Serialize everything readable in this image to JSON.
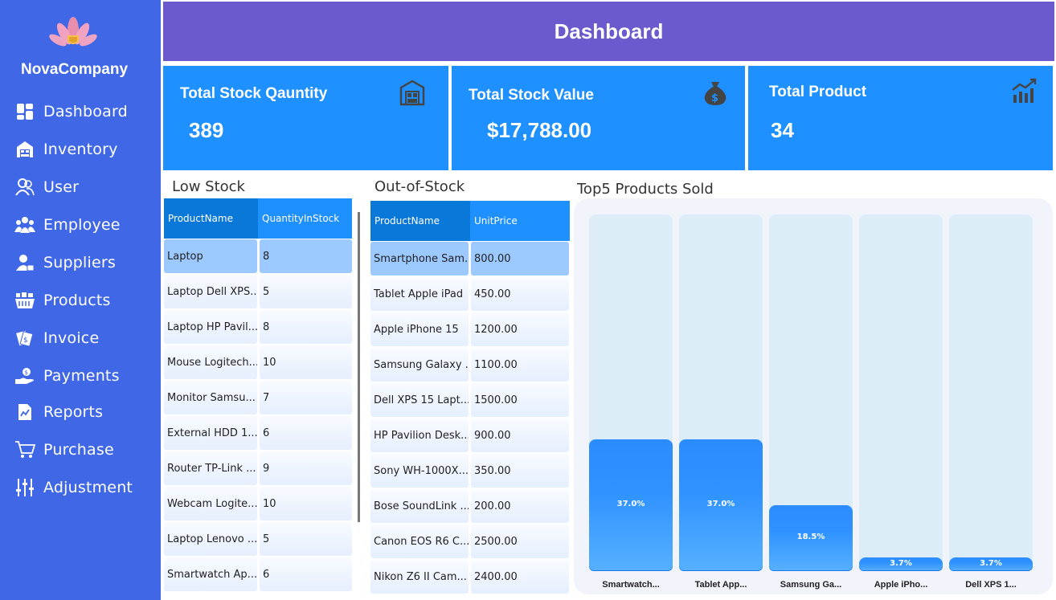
{
  "brand": {
    "name": "NovaCompany"
  },
  "sidebar": {
    "items": [
      {
        "label": "Dashboard",
        "icon": "dashboard-icon"
      },
      {
        "label": "Inventory",
        "icon": "inventory-icon"
      },
      {
        "label": "User",
        "icon": "user-icon"
      },
      {
        "label": "Employee",
        "icon": "employee-icon"
      },
      {
        "label": "Suppliers",
        "icon": "supplier-icon"
      },
      {
        "label": "Products",
        "icon": "products-icon"
      },
      {
        "label": "Invoice",
        "icon": "invoice-icon"
      },
      {
        "label": "Payments",
        "icon": "payments-icon"
      },
      {
        "label": "Reports",
        "icon": "reports-icon"
      },
      {
        "label": "Purchase",
        "icon": "cart-icon"
      },
      {
        "label": "Adjustment",
        "icon": "sliders-icon"
      }
    ]
  },
  "header": {
    "title": "Dashboard"
  },
  "cards": [
    {
      "title": "Total Stock Qauntity",
      "value": "389",
      "icon": "warehouse-icon"
    },
    {
      "title": "Total Stock Value",
      "value": "$17,788.00",
      "icon": "money-bag-icon"
    },
    {
      "title": "Total Product",
      "value": "34",
      "icon": "growth-chart-icon"
    }
  ],
  "low_stock": {
    "title": "Low Stock",
    "columns": [
      "ProductName",
      "QuantityInStock"
    ],
    "rows": [
      [
        "Laptop",
        "8"
      ],
      [
        "Laptop Dell XPS...",
        "5"
      ],
      [
        "Laptop HP Pavil...",
        "8"
      ],
      [
        "Mouse Logitech...",
        "10"
      ],
      [
        "Monitor Samsu...",
        "7"
      ],
      [
        "External HDD 1...",
        "6"
      ],
      [
        "Router TP-Link ...",
        "9"
      ],
      [
        "Webcam Logite...",
        "10"
      ],
      [
        "Laptop Lenovo ...",
        "5"
      ],
      [
        "Smartwatch Ap...",
        "6"
      ]
    ]
  },
  "out_of_stock": {
    "title": "Out-of-Stock",
    "columns": [
      "ProductName",
      "UnitPrice"
    ],
    "rows": [
      [
        "Smartphone Sam...",
        "800.00"
      ],
      [
        "Tablet Apple iPad",
        "450.00"
      ],
      [
        "Apple iPhone 15",
        "1200.00"
      ],
      [
        "Samsung Galaxy ...",
        "1100.00"
      ],
      [
        "Dell XPS 15 Lapt...",
        "1500.00"
      ],
      [
        "HP Pavilion Desk...",
        "900.00"
      ],
      [
        "Sony WH-1000X...",
        "350.00"
      ],
      [
        "Bose SoundLink ...",
        "200.00"
      ],
      [
        "Canon EOS R6 C...",
        "2500.00"
      ],
      [
        "Nikon Z6 II Cam...",
        "2400.00"
      ]
    ]
  },
  "colors": {
    "sidebar": "#3f67e6",
    "header": "#6a5acd",
    "card": "#1e90ff",
    "grid_header": "#1e90ff",
    "grid_header_active": "#0a78d8",
    "bar": "#2f92ff",
    "track": "#ddedf8"
  },
  "chart_data": {
    "type": "bar",
    "title": "Top5 Products Sold",
    "categories": [
      "Smartwatch...",
      "Tablet App...",
      "Samsung Ga...",
      "Apple iPho...",
      "Dell XPS 1..."
    ],
    "values": [
      37.0,
      37.0,
      18.5,
      3.7,
      3.7
    ],
    "labels": [
      "37.0%",
      "37.0%",
      "18.5%",
      "3.7%",
      "3.7%"
    ],
    "ylim": [
      0,
      100
    ],
    "unit": "%"
  }
}
